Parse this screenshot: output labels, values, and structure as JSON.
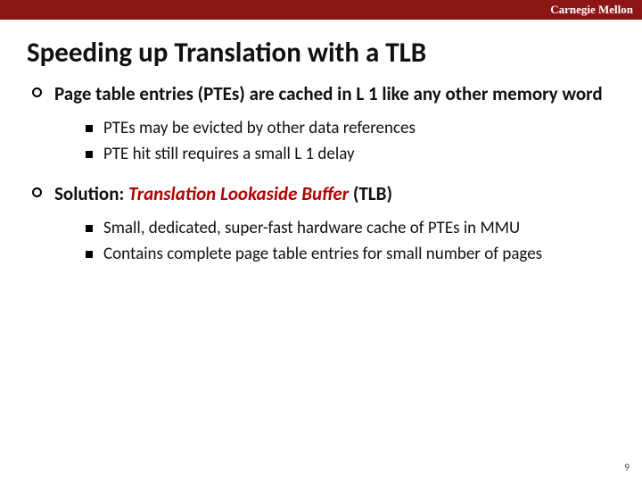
{
  "header": {
    "brand": "Carnegie Mellon"
  },
  "title": "Speeding up Translation with a TLB",
  "bullets": [
    {
      "text": "Page table entries (PTEs) are cached in L 1 like any other memory word",
      "sub": [
        "PTEs may be evicted by other data references",
        "PTE hit still requires a small L 1 delay"
      ]
    },
    {
      "prefix": "Solution: ",
      "em": "Translation Lookaside Buffer",
      "suffix": " (TLB)",
      "sub": [
        "Small, dedicated, super-fast hardware cache of PTEs in MMU",
        "Contains complete page table entries for small number of pages"
      ]
    }
  ],
  "page": "9"
}
